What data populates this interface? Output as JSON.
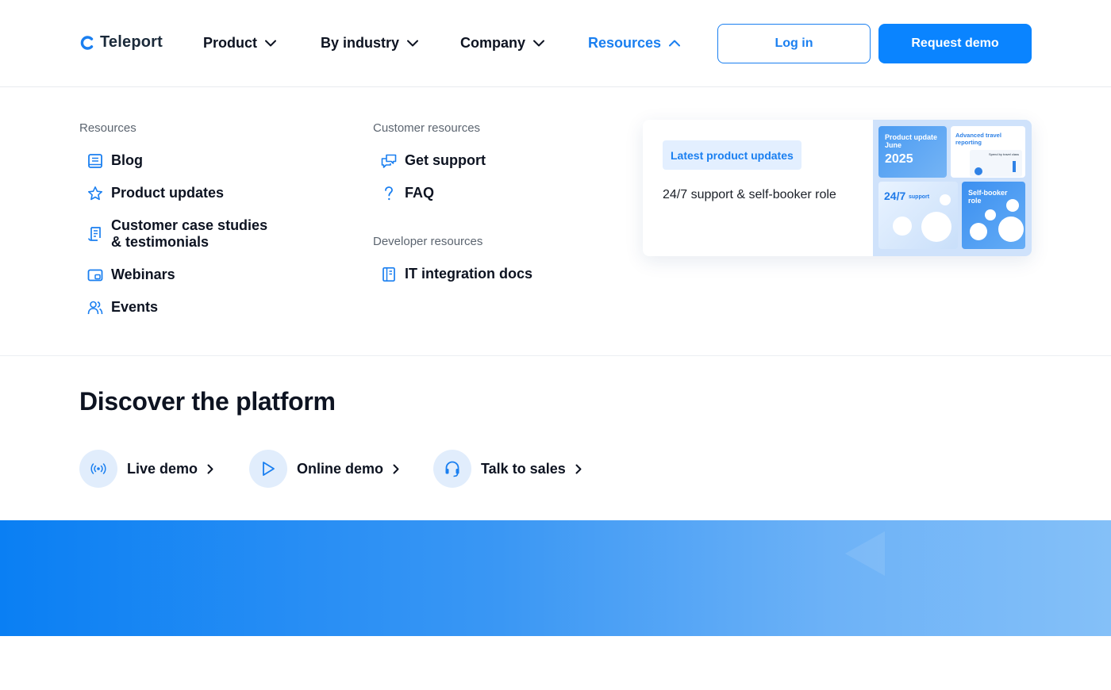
{
  "header": {
    "logo_text": "Teleport",
    "nav": [
      {
        "label": "Product"
      },
      {
        "label": "By industry"
      },
      {
        "label": "Company"
      },
      {
        "label": "Resources"
      }
    ],
    "login_label": "Log in",
    "demo_label": "Request demo"
  },
  "menu": {
    "resources": {
      "title": "Resources",
      "items": [
        {
          "label": "Blog",
          "icon": "book-icon"
        },
        {
          "label": "Product updates",
          "icon": "star-icon"
        },
        {
          "label": "Customer case studies & testimonials",
          "icon": "document-icon"
        },
        {
          "label": "Webinars",
          "icon": "screen-icon"
        },
        {
          "label": "Events",
          "icon": "users-icon"
        }
      ]
    },
    "customer": {
      "title": "Customer resources",
      "items": [
        {
          "label": "Get support",
          "icon": "chat-icon"
        },
        {
          "label": "FAQ",
          "icon": "question-icon"
        }
      ]
    },
    "developer": {
      "title": "Developer resources",
      "items": [
        {
          "label": "IT integration docs",
          "icon": "docs-icon"
        }
      ]
    }
  },
  "promo": {
    "badge": "Latest product updates",
    "text": "24/7 support & self-booker role",
    "tiles": {
      "t1_title": "Product update June",
      "t1_year": "2025",
      "t2_title": "Advanced travel reporting",
      "t2_sub": "Spend by travel class",
      "t3_title": "24/7",
      "t3_sub": "support",
      "t4_title": "Self-booker role"
    }
  },
  "discover": {
    "title": "Discover the platform",
    "links": [
      {
        "label": "Live demo",
        "icon": "broadcast-icon"
      },
      {
        "label": "Online demo",
        "icon": "play-icon"
      },
      {
        "label": "Talk to sales",
        "icon": "headset-icon"
      }
    ]
  },
  "colors": {
    "accent": "#0a84ff",
    "accent_text": "#1a7ff0",
    "text": "#0d1321",
    "muted": "#5c6570"
  }
}
